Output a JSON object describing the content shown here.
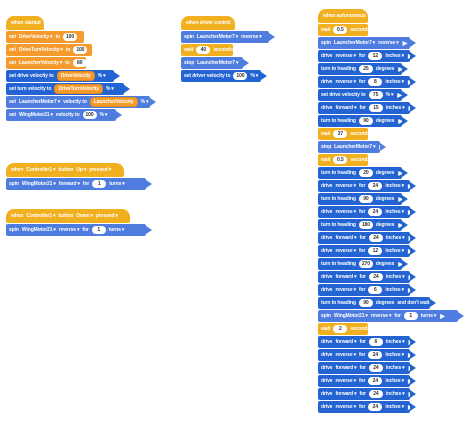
{
  "stack1": {
    "hat": "when started",
    "rows": [
      {
        "kw": "set",
        "v": "DriveVelocity",
        "to": "to",
        "n": "100"
      },
      {
        "kw": "set",
        "v": "DriveTurnVelocity",
        "to": "to",
        "n": "100"
      },
      {
        "kw": "set",
        "v": "LauncherVelocity",
        "to": "to",
        "n": "80"
      },
      {
        "a": "set drive velocity to",
        "v": "DriveVelocity",
        "u": "%"
      },
      {
        "a": "set turn velocity to",
        "v": "DriveTurnVelocity",
        "u": "%"
      },
      {
        "kw": "set",
        "m": "LauncherMotor7",
        "b": "velocity to",
        "v": "LauncherVelocity",
        "u": "%"
      },
      {
        "kw": "set",
        "m": "WingMotor21",
        "b": "velocity to",
        "n": "100",
        "u": "%"
      }
    ]
  },
  "stack2": {
    "hat": "when driver control",
    "spin": {
      "kw": "spin",
      "m": "LauncherMotor7",
      "d": "reverse"
    },
    "wait": {
      "kw": "wait",
      "n": "40",
      "u": "seconds"
    },
    "stop": {
      "kw": "stop",
      "m": "LauncherMotor7"
    },
    "setv": {
      "a": "set driver velocity to",
      "n": "100",
      "u": "%"
    }
  },
  "stack3": {
    "hat": {
      "w": "when",
      "c": "Controller1",
      "b": "button",
      "btn": "Up",
      "s": "pressed"
    },
    "spin": {
      "kw": "spin",
      "m": "WingMotor21",
      "d": "forward",
      "f": "for",
      "n": "1",
      "u": "turns"
    }
  },
  "stack4": {
    "hat": {
      "w": "when",
      "c": "Controller1",
      "b": "button",
      "btn": "Down",
      "s": "pressed"
    },
    "spin": {
      "kw": "spin",
      "m": "WingMotor21",
      "d": "reverse",
      "f": "for",
      "n": "1",
      "u": "turns"
    }
  },
  "stack5": {
    "hat": "when autonomous",
    "rows": [
      {
        "t": "wait",
        "n": "0.5",
        "u": "seconds"
      },
      {
        "t": "spin",
        "m": "LauncherMotor7",
        "d": "reverse"
      },
      {
        "t": "drive",
        "d": "reverse",
        "n": "12",
        "u": "inches"
      },
      {
        "t": "turn",
        "n": "25",
        "u": "degrees"
      },
      {
        "t": "drive",
        "d": "reverse",
        "n": "8",
        "u": "inches"
      },
      {
        "t": "setv",
        "n": "75",
        "u": "%"
      },
      {
        "t": "drive",
        "d": "forward",
        "n": "15",
        "u": "inches"
      },
      {
        "t": "turn",
        "n": "90",
        "u": "degrees"
      },
      {
        "t": "wait",
        "n": "37",
        "u": "seconds"
      },
      {
        "t": "stop",
        "m": "LauncherMotor7"
      },
      {
        "t": "wait",
        "n": "0.5",
        "u": "seconds"
      },
      {
        "t": "turn",
        "n": "20",
        "u": "degrees"
      },
      {
        "t": "drive",
        "d": "reverse",
        "n": "24",
        "u": "inches"
      },
      {
        "t": "turn",
        "n": "90",
        "u": "degrees"
      },
      {
        "t": "drive",
        "d": "reverse",
        "n": "24",
        "u": "inches"
      },
      {
        "t": "turn",
        "n": "180",
        "u": "degrees"
      },
      {
        "t": "drive",
        "d": "forward",
        "n": "24",
        "u": "inches"
      },
      {
        "t": "drive",
        "d": "reverse",
        "n": "12",
        "u": "inches"
      },
      {
        "t": "turn",
        "n": "270",
        "u": "degrees"
      },
      {
        "t": "drive",
        "d": "forward",
        "n": "24",
        "u": "inches"
      },
      {
        "t": "drive",
        "d": "reverse",
        "n": "6",
        "u": "inches"
      },
      {
        "t": "turn2",
        "n": "90",
        "u": "degrees",
        "x": "and don't wait"
      },
      {
        "t": "spin2",
        "m": "WingMotor21",
        "d": "reverse",
        "f": "for",
        "n": "1",
        "u": "turns"
      },
      {
        "t": "wait",
        "n": "2",
        "u": "seconds"
      },
      {
        "t": "drive",
        "d": "forward",
        "n": "6",
        "u": "inches"
      },
      {
        "t": "drive",
        "d": "reverse",
        "n": "24",
        "u": "inches"
      },
      {
        "t": "drive",
        "d": "forward",
        "n": "24",
        "u": "inches"
      },
      {
        "t": "drive",
        "d": "reverse",
        "n": "24",
        "u": "inches"
      },
      {
        "t": "drive",
        "d": "forward",
        "n": "24",
        "u": "inches"
      },
      {
        "t": "drive",
        "d": "reverse",
        "n": "24",
        "u": "inches"
      }
    ],
    "labels": {
      "drive": "drive",
      "turn": "turn to heading",
      "setv": "set drive velocity to",
      "wait": "wait",
      "spin": "spin",
      "stop": "stop",
      "for": "for"
    }
  },
  "colors": {
    "events": "#f0b020",
    "variables": "#f59b2d",
    "motion": "#4f7ddf",
    "drivetrain": "#2364d2"
  }
}
